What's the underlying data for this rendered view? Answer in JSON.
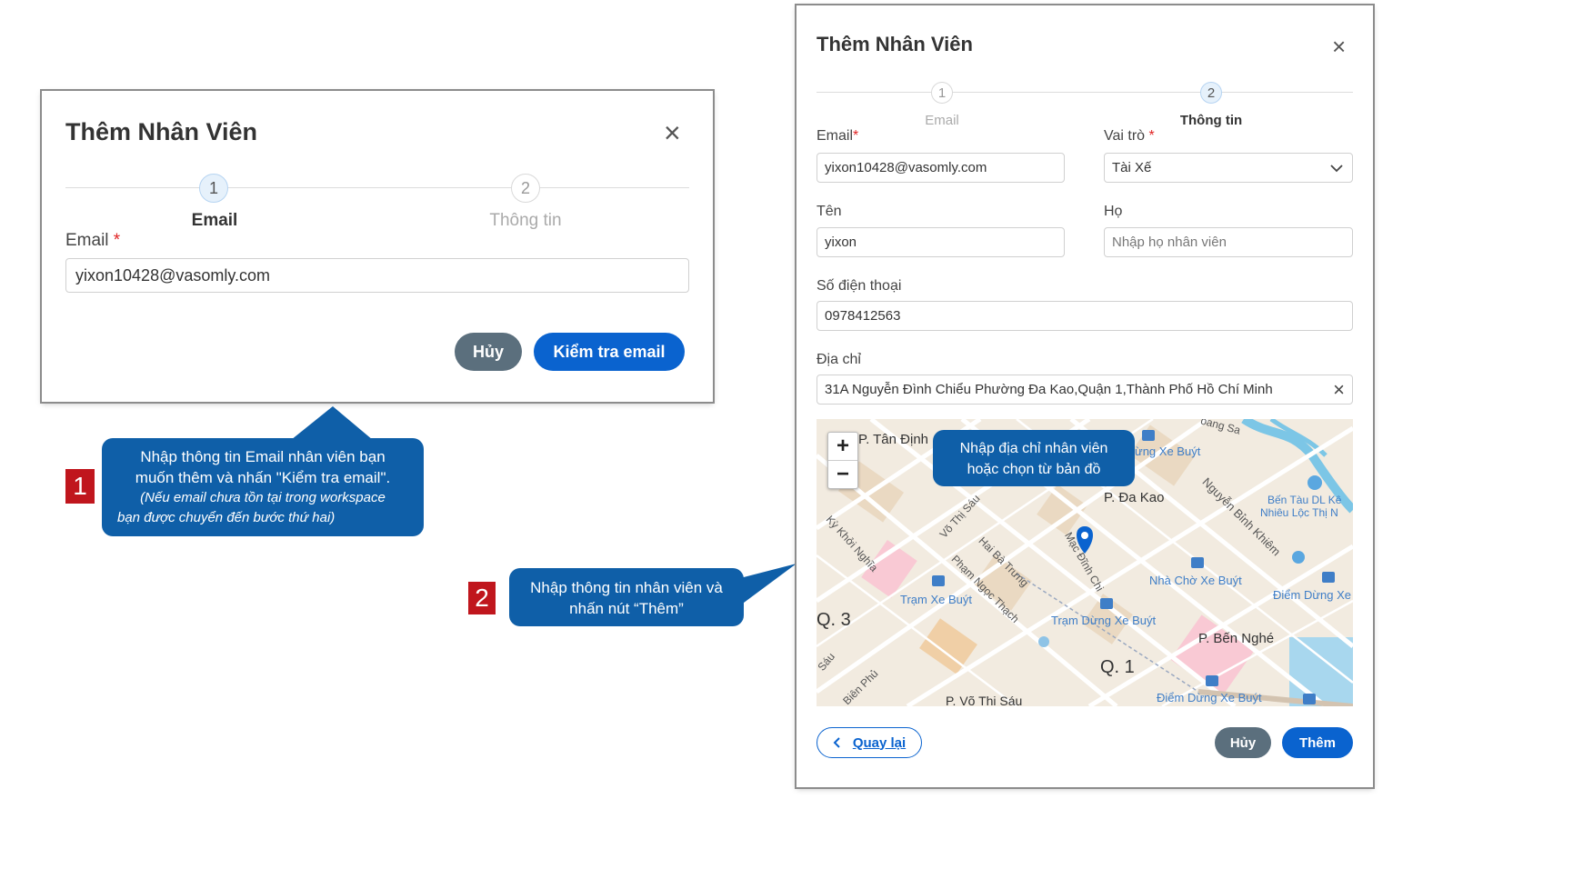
{
  "modal1": {
    "title": "Thêm Nhân Viên",
    "close": "×",
    "steps": [
      {
        "number": "1",
        "label": "Email"
      },
      {
        "number": "2",
        "label": "Thông tin"
      }
    ],
    "email_label": "Email",
    "required_mark": "*",
    "email_value": "yixon10428@vasomly.com",
    "cancel_label": "Hủy",
    "check_label": "Kiểm tra email"
  },
  "modal2": {
    "title": "Thêm Nhân Viên",
    "close": "×",
    "steps": [
      {
        "number": "1",
        "label": "Email"
      },
      {
        "number": "2",
        "label": "Thông tin"
      }
    ],
    "email_label": "Email",
    "required_mark": "*",
    "email_value": "yixon10428@vasomly.com",
    "role_label": "Vai trò",
    "role_value": "Tài Xế",
    "first_name_label": "Tên",
    "first_name_value": "yixon",
    "last_name_label": "Họ",
    "last_name_placeholder": "Nhập họ nhân viên",
    "phone_label": "Số điện thoại",
    "phone_value": "0978412563",
    "address_label": "Địa chỉ",
    "address_value": "31A Nguyễn Đình Chiểu Phường Đa Kao,Quận 1,Thành Phố Hồ Chí Minh",
    "clear": "×",
    "back_label": "Quay lại",
    "cancel_label": "Hủy",
    "add_label": "Thêm",
    "map": {
      "zoom_in": "+",
      "zoom_out": "−",
      "labels": {
        "tan_dinh": "P. Tân Định",
        "da_kao": "P. Đa Kao",
        "q3": "Q. 3",
        "q1": "Q. 1",
        "ben_nghe": "P. Bến Nghé",
        "vo_thi_sau": "P. Võ Thị Sáu",
        "tram_xe_buyt": "Trạm Xe Buýt",
        "tram_dung_xe_buyt": "Trạm Dừng Xe Buýt",
        "nha_cho_xe_buyt": "Nhà Chờ Xe Buýt",
        "diem_dung_xe_buyt": "Điểm Dừng Xe Buýt",
        "diem_dung_xe": "Điểm Dừng Xe",
        "ung_xe_buyt": "ừng Xe Buýt",
        "ben_tau": "Bến Tàu DL Kê",
        "nhieu_loc": "Nhiêu Lộc Thị N",
        "hoang_sa": "oang Sa",
        "nguyen_binh_khiem": "Nguyễn Bỉnh Khiêm",
        "vo_thi_sau_st": "Võ Thị Sáu",
        "hai_ba_trung": "Hai Bà Trưng",
        "pham_ngoc_thach": "Phạm Ngọc Thạch",
        "ky_khoi_nghia": "Kỳ Khởi Nghĩa",
        "minh_chi": "Mạc Đĩnh Chi",
        "ben_phu": "Biên Phủ",
        "sau": "Sáu"
      }
    }
  },
  "callouts": {
    "step1_number": "1",
    "step1_line1": "Nhập thông tin Email nhân viên bạn",
    "step1_line2": "muốn thêm và nhấn \"Kiểm tra email\".",
    "step1_italic1": "(Nếu email chưa tồn tại trong workspace",
    "step1_italic2": "bạn được chuyển đến bước thứ hai)",
    "step2_number": "2",
    "step2_line1": "Nhập thông tin nhân viên và",
    "step2_line2": "nhấn nút “Thêm”",
    "map_line1": "Nhập địa chỉ nhân viên",
    "map_line2": "hoặc chọn từ bản đồ"
  }
}
